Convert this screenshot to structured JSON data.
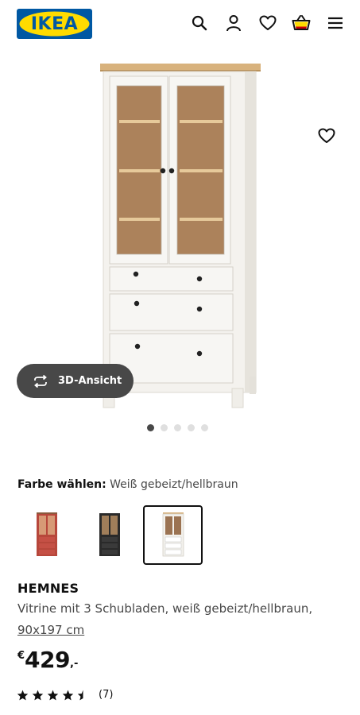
{
  "header": {
    "logo_text": "IKEA",
    "logo_colors": {
      "background": "#0058a3",
      "shape": "#ffdb00",
      "text": "#0058a3"
    },
    "icons": [
      "search-icon",
      "account-icon",
      "wishlist-heart-icon",
      "shopping-bag-icon",
      "menu-icon"
    ]
  },
  "gallery": {
    "favourite_icon": "heart-outline-icon",
    "button_3d": {
      "icon": "rotate-arrows-icon",
      "label": "3D-Ansicht"
    },
    "carousel": {
      "total": 5,
      "active_index": 0
    }
  },
  "color_selector": {
    "label": "Farbe wählen:",
    "selected_value": "Weiß gebeizt/hellbraun",
    "options": [
      {
        "name": "rot",
        "color": "#b7473b",
        "selected": false
      },
      {
        "name": "schwarz",
        "color": "#2a2a2a",
        "selected": false
      },
      {
        "name": "weiß gebeizt/hellbraun",
        "color": "#f3f1ec",
        "selected": true
      }
    ]
  },
  "product": {
    "name": "HEMNES",
    "description": "Vitrine mit 3 Schubladen, weiß gebeizt/hellbraun,",
    "measurement": "90x197 cm",
    "price": {
      "currency": "€",
      "amount": "429",
      "decimals": ",-"
    },
    "rating": {
      "value": 4.5,
      "max": 5,
      "count_text": "(7)"
    }
  }
}
